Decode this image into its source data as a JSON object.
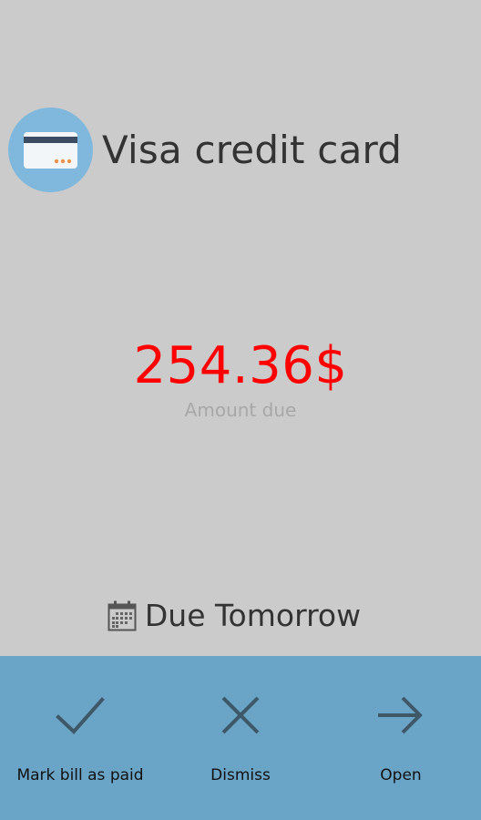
{
  "bill": {
    "title": "Visa credit card",
    "amount": "254.36$",
    "amount_label": "Amount due",
    "due_text": "Due Tomorrow"
  },
  "icons": {
    "avatar": "credit-card-icon",
    "due": "calendar-icon"
  },
  "actions": [
    {
      "label": "Mark bill as paid",
      "icon": "checkmark-icon"
    },
    {
      "label": "Dismiss",
      "icon": "close-icon"
    },
    {
      "label": "Open",
      "icon": "arrow-right-icon"
    }
  ],
  "colors": {
    "background": "#cbcbcb",
    "avatar_bg": "#7fb8dc",
    "amount": "#ff0000",
    "action_bar": "#6aa4c6",
    "action_icon": "#3f5868"
  }
}
